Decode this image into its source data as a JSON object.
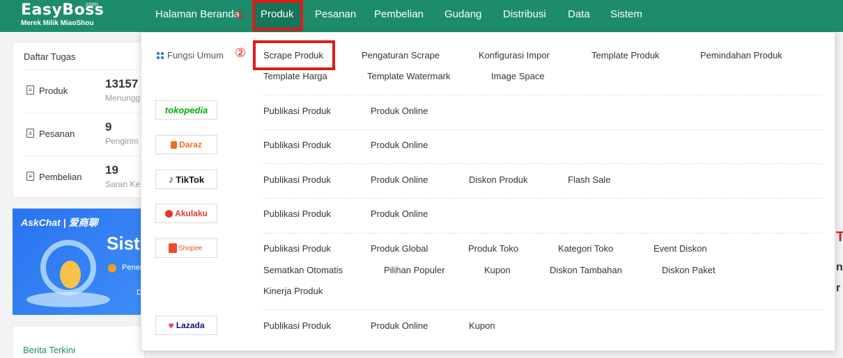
{
  "brand": {
    "name": "EasyBoss",
    "tld": ".com",
    "tagline": "Merek Milik MiaoShou"
  },
  "nav": {
    "items": [
      "Halaman Beranda",
      "Produk",
      "Pesanan",
      "Pembelian",
      "Gudang",
      "Distribusi",
      "Data",
      "Sistem"
    ],
    "active": "Produk"
  },
  "annotations": {
    "step1": "①",
    "step2": "②",
    "box_color": "#e21b1b"
  },
  "tasks": {
    "title": "Daftar Tugas",
    "rows": [
      {
        "label": "Produk",
        "value": "13157",
        "sub": "Menungg"
      },
      {
        "label": "Pesanan",
        "value": "9",
        "sub": "Pengirim"
      },
      {
        "label": "Pembelian",
        "value": "19",
        "sub": "Saran Ke"
      }
    ]
  },
  "banner": {
    "logo": "AskChat | 爱商聊",
    "title": "Sist",
    "sub": "Pener",
    "footer": "D"
  },
  "news": {
    "title": "Berita Terkini"
  },
  "right_fragments": [
    "Tu",
    "n",
    "r"
  ],
  "dropdown": {
    "common_label": "Fungsi Umum",
    "common_links": [
      "Scrape Produk",
      "Pengaturan Scrape",
      "Konfigurasi Impor",
      "Template Produk",
      "Pemindahan Produk",
      "Template Harga",
      "Template Watermark",
      "Image Space"
    ],
    "platforms": [
      {
        "name": "tokopedia",
        "color": "#03ac0e",
        "links": [
          "Publikasi Produk",
          "Produk Online"
        ]
      },
      {
        "name": "Daraz",
        "color": "#f36e22",
        "links": [
          "Publikasi Produk",
          "Produk Online"
        ]
      },
      {
        "name": "TikTok",
        "color": "#111111",
        "links": [
          "Publikasi Produk",
          "Produk Online",
          "Diskon Produk",
          "Flash Sale"
        ]
      },
      {
        "name": "Akulaku",
        "color": "#e8372c",
        "links": [
          "Publikasi Produk",
          "Produk Online"
        ]
      },
      {
        "name": "Shopee",
        "color": "#ee4d2d",
        "links": [
          "Publikasi Produk",
          "Produk Global",
          "Produk Toko",
          "Kategori Toko",
          "Event Diskon",
          "Sematkan Otomatis",
          "Pilihan Populer",
          "Kupon",
          "Diskon Tambahan",
          "Diskon Paket",
          "Kinerja Produk"
        ]
      },
      {
        "name": "Lazada",
        "color": "#0f136d",
        "links": [
          "Publikasi Produk",
          "Produk Online",
          "Kupon"
        ]
      }
    ]
  },
  "colors": {
    "header": "#1c8c6c",
    "accent": "#3578e5"
  }
}
